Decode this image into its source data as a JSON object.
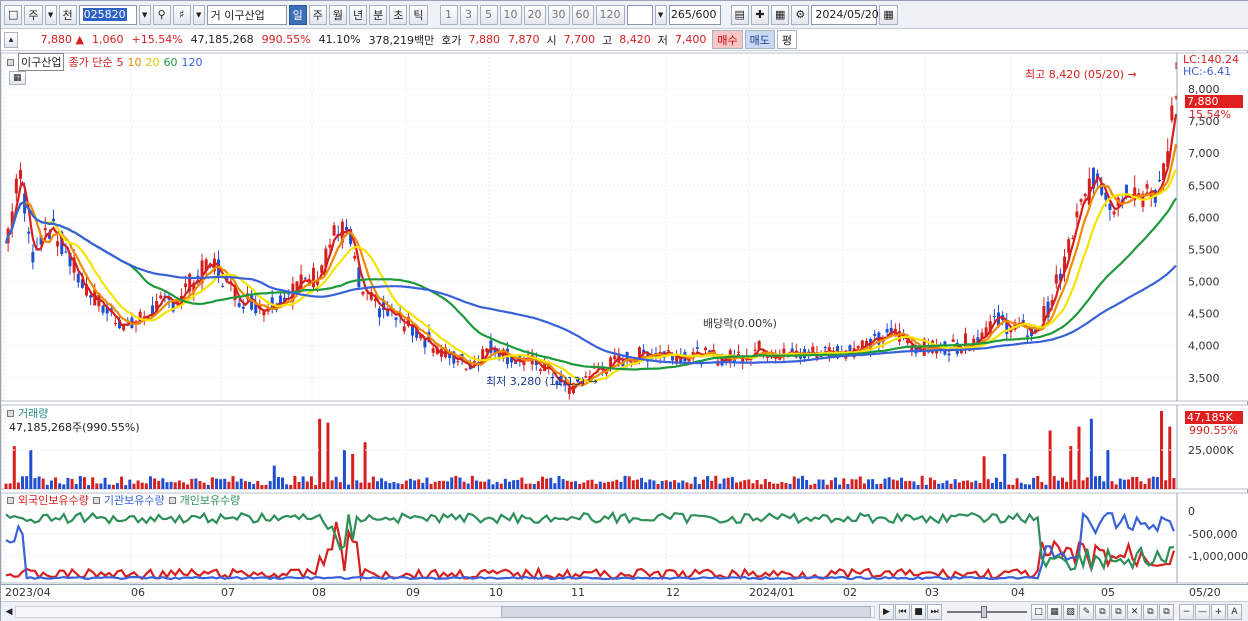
{
  "toolbar": {
    "period_type": "주",
    "prev_label": "전",
    "stock_code": "025820",
    "market_prefix": "거",
    "stock_name": "이구산업",
    "periods": [
      "일",
      "주",
      "월",
      "년",
      "분",
      "초",
      "틱"
    ],
    "active_period": "일",
    "intervals": [
      "1",
      "3",
      "5",
      "10",
      "20",
      "30",
      "60",
      "120"
    ],
    "count": "265",
    "count_max": "/600",
    "date": "2024/05/20"
  },
  "quote": {
    "price": "7,880",
    "change": "1,060",
    "change_pct": "+15.54%",
    "volume": "47,185,268",
    "volume_pct": "990.55%",
    "turnover": "41.10%",
    "amount": "378,219백만",
    "bid_label": "호가",
    "ask": "7,880",
    "bid": "7,870",
    "open_label": "시",
    "open": "7,700",
    "high_label": "고",
    "high": "8,420",
    "low_label": "저",
    "low": "7,400",
    "buy_label": "매수",
    "sell_label": "매도",
    "avg_label": "평"
  },
  "price_panel": {
    "stock_label": "이구산업",
    "legend_prefix": "종가 단순",
    "ma_periods": [
      "5",
      "10",
      "20",
      "60",
      "120"
    ],
    "ma_colors": [
      "#d6201f",
      "#f08a00",
      "#f4e400",
      "#1f9a3a",
      "#3a62d8"
    ],
    "lc": "LC:140.24",
    "hc": "HC:-6.41",
    "current_price": "7,880",
    "current_pct": "15.54%",
    "high_annotation": "최고 8,420 (05/20)",
    "low_annotation": "최저 3,280 (11/13)",
    "ex_div_annotation": "배당락(0.00%)",
    "y_ticks": [
      "8,000",
      "7,500",
      "7,000",
      "6,500",
      "6,000",
      "5,500",
      "5,000",
      "4,500",
      "4,000",
      "3,500"
    ]
  },
  "volume_panel": {
    "title": "거래량",
    "subtitle": "47,185,268주(990.55%)",
    "current": "47,185K",
    "current_pct": "990.55%",
    "y_ticks": [
      "25,000K"
    ]
  },
  "holdings_panel": {
    "legends": [
      "외국인보유수량",
      "기관보유수량",
      "개인보유수량"
    ],
    "colors": [
      "#d6201f",
      "#3a62d8",
      "#2f8f5a"
    ],
    "y_ticks": [
      "0",
      "-500,000",
      "-1,000,000"
    ]
  },
  "x_axis": {
    "labels": [
      "2023/04",
      "06",
      "07",
      "08",
      "09",
      "10",
      "11",
      "12",
      "2024/01",
      "02",
      "03",
      "04",
      "05"
    ],
    "right_label": "05/20"
  },
  "chart_data": {
    "type": "candlestick",
    "current": 7880,
    "high": {
      "value": 8420,
      "date": "05/20"
    },
    "low": {
      "value": 3280,
      "date": "11/13"
    },
    "ylim": [
      3200,
      8500
    ],
    "close_anchors": [
      [
        0,
        5600
      ],
      [
        6,
        6800
      ],
      [
        12,
        5400
      ],
      [
        20,
        5900
      ],
      [
        28,
        5500
      ],
      [
        38,
        4900
      ],
      [
        50,
        4500
      ],
      [
        60,
        4300
      ],
      [
        72,
        4600
      ],
      [
        82,
        4700
      ],
      [
        90,
        5000
      ],
      [
        100,
        5300
      ],
      [
        110,
        4800
      ],
      [
        125,
        4600
      ],
      [
        140,
        4900
      ],
      [
        150,
        5100
      ],
      [
        158,
        5700
      ],
      [
        165,
        5800
      ],
      [
        172,
        4800
      ],
      [
        180,
        4600
      ],
      [
        190,
        4400
      ],
      [
        200,
        4200
      ],
      [
        210,
        3900
      ],
      [
        225,
        3700
      ],
      [
        235,
        4000
      ],
      [
        245,
        3800
      ],
      [
        260,
        3700
      ],
      [
        272,
        3300
      ],
      [
        285,
        3600
      ],
      [
        300,
        3800
      ],
      [
        315,
        3900
      ],
      [
        335,
        3850
      ],
      [
        350,
        3800
      ],
      [
        365,
        3950
      ],
      [
        380,
        3850
      ],
      [
        395,
        3900
      ],
      [
        410,
        3950
      ],
      [
        420,
        4050
      ],
      [
        430,
        4200
      ],
      [
        440,
        4000
      ],
      [
        450,
        3950
      ],
      [
        460,
        4000
      ],
      [
        470,
        4100
      ],
      [
        478,
        4400
      ],
      [
        488,
        4300
      ],
      [
        498,
        4200
      ],
      [
        505,
        4600
      ],
      [
        512,
        5200
      ],
      [
        520,
        6100
      ],
      [
        528,
        6700
      ],
      [
        536,
        6200
      ],
      [
        544,
        6500
      ],
      [
        552,
        6300
      ],
      [
        558,
        6400
      ],
      [
        562,
        7000
      ],
      [
        566,
        7880
      ]
    ],
    "volume_spikes": [
      [
        4,
        0.55
      ],
      [
        12,
        0.5
      ],
      [
        130,
        0.3
      ],
      [
        152,
        0.9
      ],
      [
        156,
        0.85
      ],
      [
        164,
        0.5
      ],
      [
        168,
        0.45
      ],
      [
        174,
        0.6
      ],
      [
        474,
        0.42
      ],
      [
        484,
        0.45
      ],
      [
        506,
        0.75
      ],
      [
        516,
        0.55
      ],
      [
        520,
        0.8
      ],
      [
        526,
        0.9
      ],
      [
        534,
        0.5
      ],
      [
        560,
        1.0
      ],
      [
        564,
        0.8
      ]
    ]
  }
}
